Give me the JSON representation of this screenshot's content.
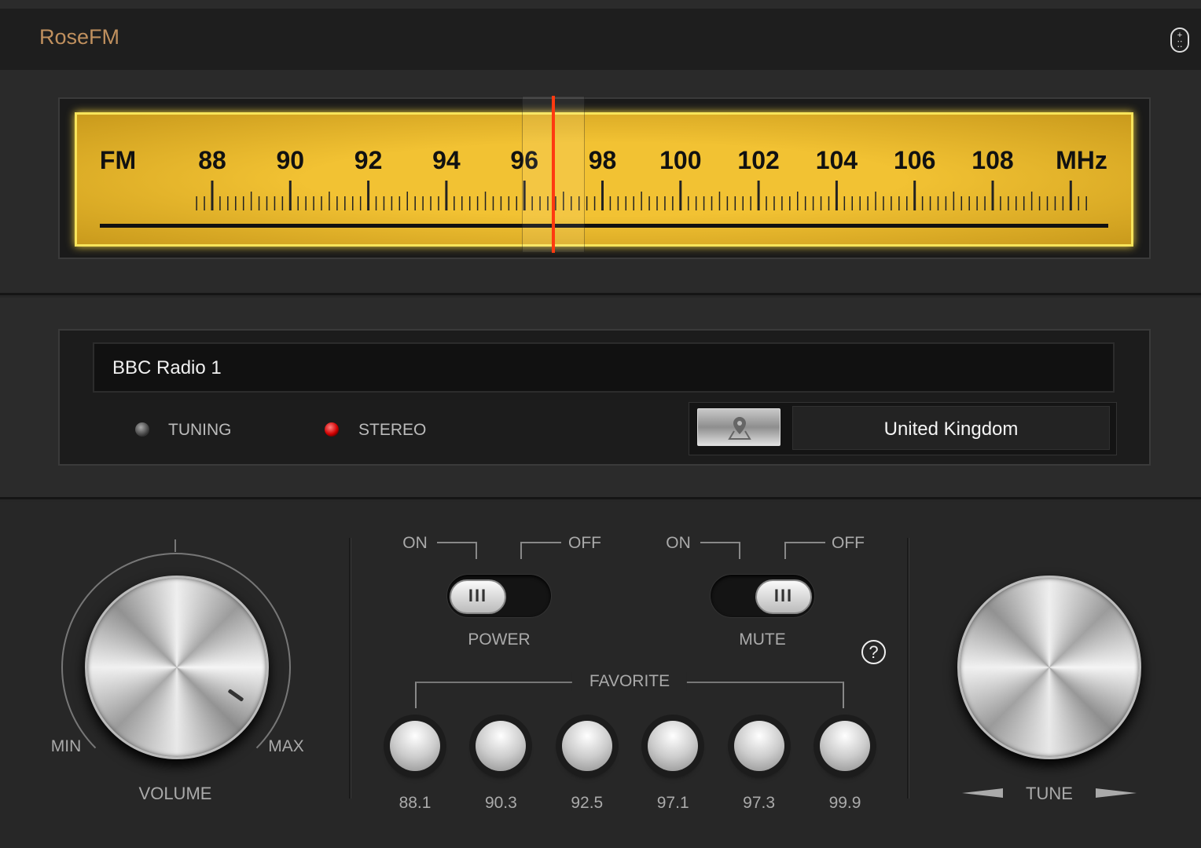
{
  "app": {
    "title": "RoseFM"
  },
  "dial": {
    "band": "FM",
    "unit": "MHz",
    "marks": [
      "88",
      "90",
      "92",
      "94",
      "96",
      "98",
      "100",
      "102",
      "104",
      "106",
      "108"
    ],
    "min_mhz": 87.6,
    "max_mhz": 110.4,
    "tuned_mhz": 96.75,
    "needle_color": "#ff3a10"
  },
  "station": {
    "name": "BBC Radio 1",
    "tuning_label": "TUNING",
    "stereo_label": "STEREO",
    "tuning_on": false,
    "stereo_on": true,
    "country": "United Kingdom"
  },
  "volume": {
    "label": "VOLUME",
    "min": "MIN",
    "max": "MAX"
  },
  "power": {
    "on": "ON",
    "off": "OFF",
    "label": "POWER",
    "state": "on"
  },
  "mute": {
    "on": "ON",
    "off": "OFF",
    "label": "MUTE",
    "state": "off"
  },
  "favorite": {
    "label": "FAVORITE",
    "stations": [
      "88.1",
      "90.3",
      "92.5",
      "97.1",
      "97.3",
      "99.9"
    ]
  },
  "tune": {
    "label": "TUNE"
  },
  "help": "?"
}
